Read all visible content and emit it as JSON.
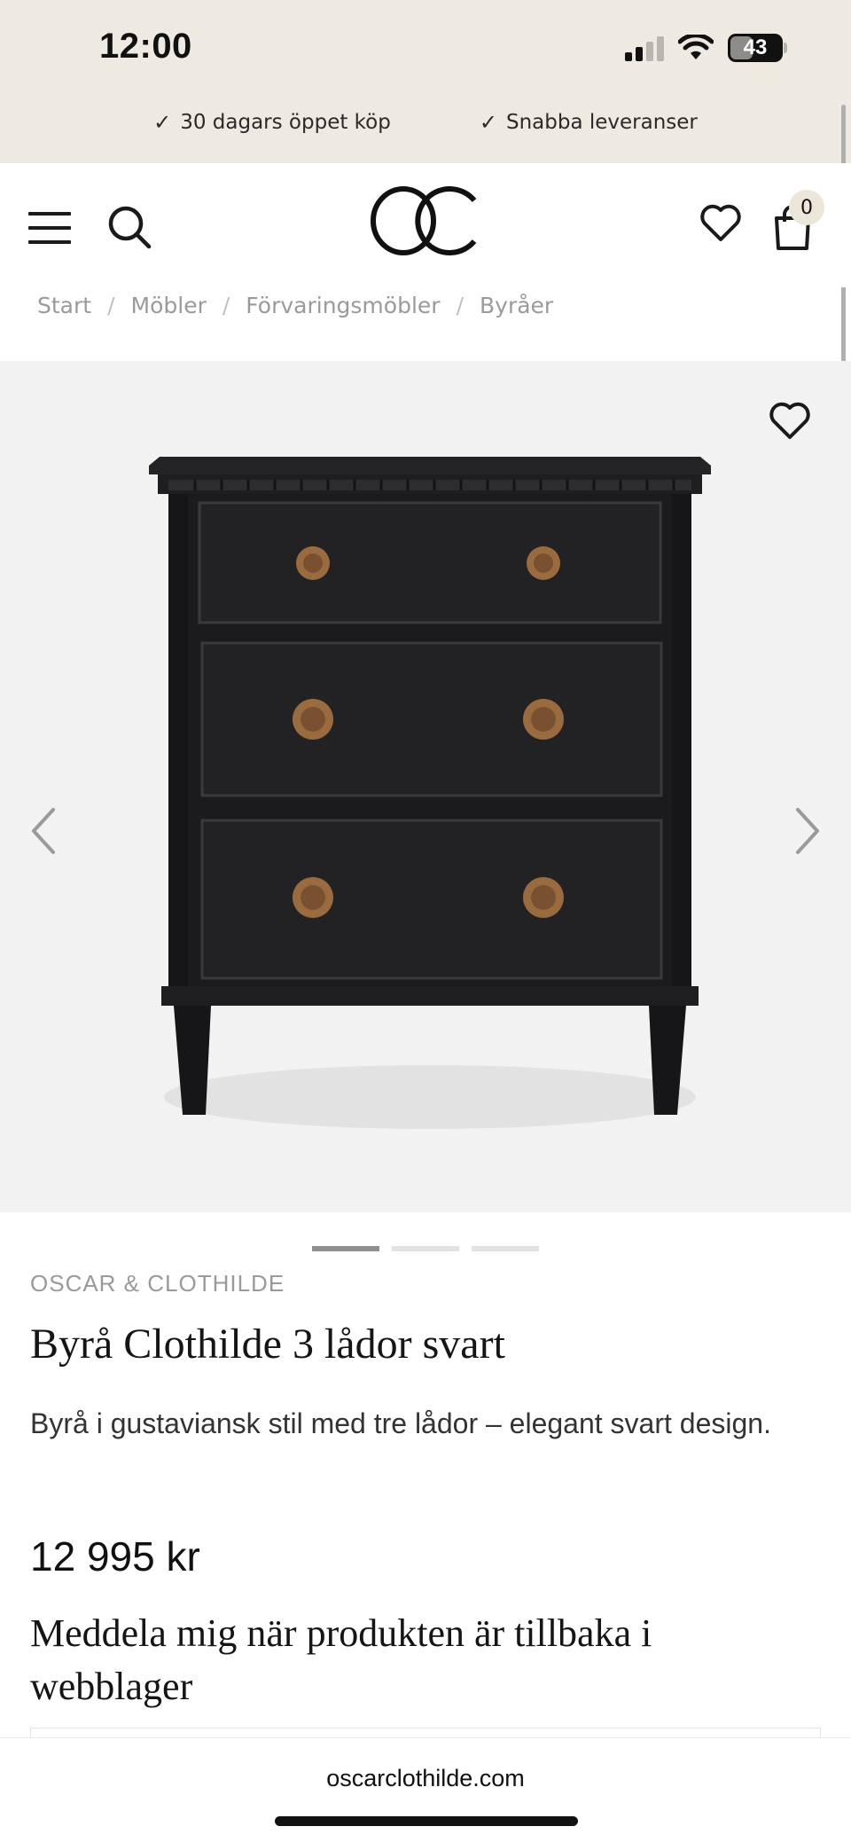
{
  "status_bar": {
    "time": "12:00",
    "battery": "43"
  },
  "usp": [
    {
      "text": "30 dagars öppet köp"
    },
    {
      "text": "Snabba leveranser"
    }
  ],
  "header": {
    "logo": "OC",
    "cart_count": "0"
  },
  "breadcrumb": [
    "Start",
    "Möbler",
    "Förvaringsmöbler",
    "Byråer"
  ],
  "breadcrumb_separator": "/",
  "gallery": {
    "slide_count": 3,
    "active_slide": 1
  },
  "product": {
    "brand": "OSCAR & CLOTHILDE",
    "title": "Byrå Clothilde 3 lådor svart",
    "description": "Byrå i gustaviansk stil med tre lådor – elegant svart design.",
    "price": "12 995 kr",
    "notify_heading": "Meddela mig när produkten är tillbaka i webblager"
  },
  "browser": {
    "url": "oscarclothilde.com"
  },
  "colors": {
    "top_band": "#eeeae2",
    "gallery_bg": "#f2f2f2",
    "dresser": "#1b1b1d",
    "hardware": "#9a6b3f"
  }
}
